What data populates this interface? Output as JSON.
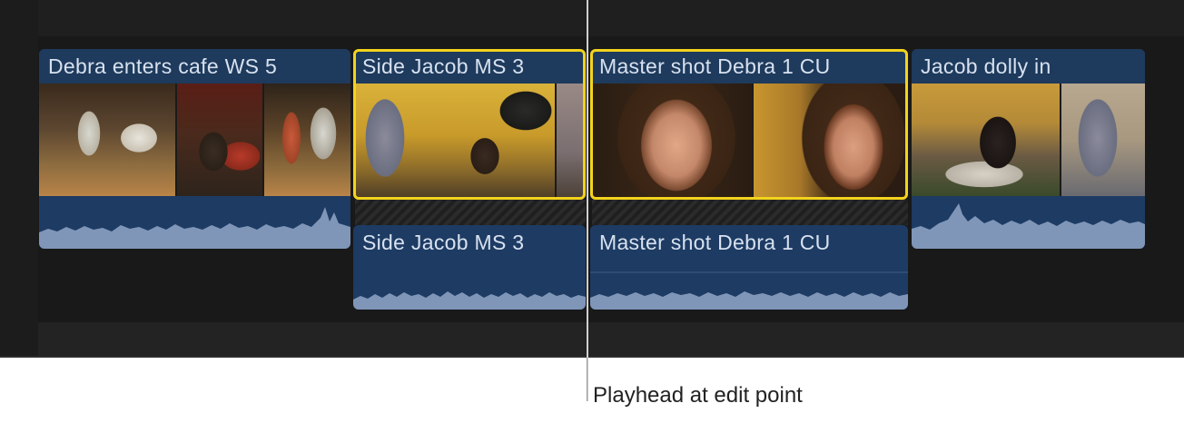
{
  "timeline": {
    "clips": [
      {
        "name": "Debra enters cafe WS 5",
        "selected": false
      },
      {
        "name": "Side Jacob MS 3",
        "selected": true
      },
      {
        "name": "Master shot Debra 1 CU",
        "selected": true
      },
      {
        "name": "Jacob dolly in",
        "selected": false
      }
    ],
    "detached_audio": [
      {
        "name": "Side Jacob MS 3"
      },
      {
        "name": "Master shot Debra 1 CU"
      }
    ],
    "colors": {
      "clip_title_bg": "#1e3a5c",
      "audio_bg": "#1d3b63",
      "waveform": "#7f96b9",
      "selection": "#f3d31c",
      "playhead": "#cfcfcf"
    }
  },
  "callout": {
    "playhead_label": "Playhead at edit point"
  }
}
